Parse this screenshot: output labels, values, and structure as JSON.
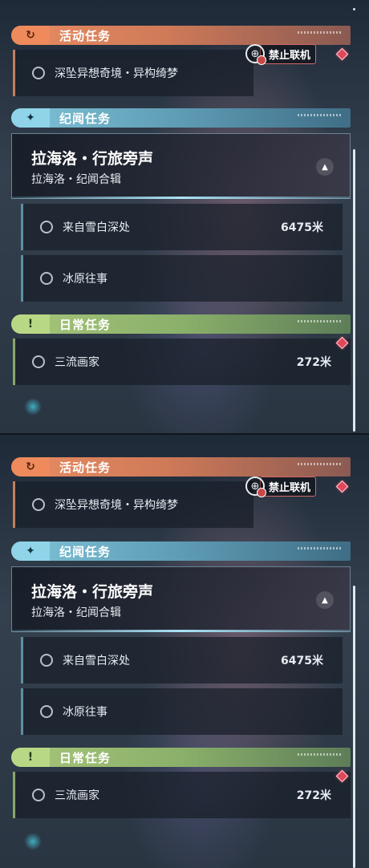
{
  "panels": [
    {
      "activity": {
        "header": "活动任务",
        "quest": "深坠异想奇境・异构绮梦",
        "badge_icon": "↻",
        "status_label": "禁止联机",
        "status_icon": "no-multiplayer-globe"
      },
      "story": {
        "header": "纪闻任务",
        "badge_icon": "✦",
        "featured_title": "拉海洛・行旅旁声",
        "featured_subtitle": "拉海洛・纪闻合辑",
        "items": [
          {
            "name": "来自雪白深处",
            "distance": "6475米"
          },
          {
            "name": "冰原往事",
            "distance": ""
          }
        ]
      },
      "daily": {
        "header": "日常任务",
        "badge_icon": "!",
        "items": [
          {
            "name": "三流画家",
            "distance": "272米"
          }
        ]
      }
    },
    {
      "activity": {
        "header": "活动任务",
        "quest": "深坠异想奇境・异构绮梦",
        "badge_icon": "↻",
        "status_label": "禁止联机",
        "status_icon": "no-multiplayer-globe"
      },
      "story": {
        "header": "纪闻任务",
        "badge_icon": "✦",
        "featured_title": "拉海洛・行旅旁声",
        "featured_subtitle": "拉海洛・纪闻合辑",
        "items": [
          {
            "name": "来自雪白深处",
            "distance": "6475米"
          },
          {
            "name": "冰原往事",
            "distance": ""
          }
        ]
      },
      "daily": {
        "header": "日常任务",
        "badge_icon": "!",
        "items": [
          {
            "name": "三流画家",
            "distance": "272米"
          }
        ]
      }
    }
  ],
  "colors": {
    "activity": "#ee8a5c",
    "story": "#8fd4e8",
    "daily": "#b9d886",
    "tracker_marker": "#e0475a"
  }
}
